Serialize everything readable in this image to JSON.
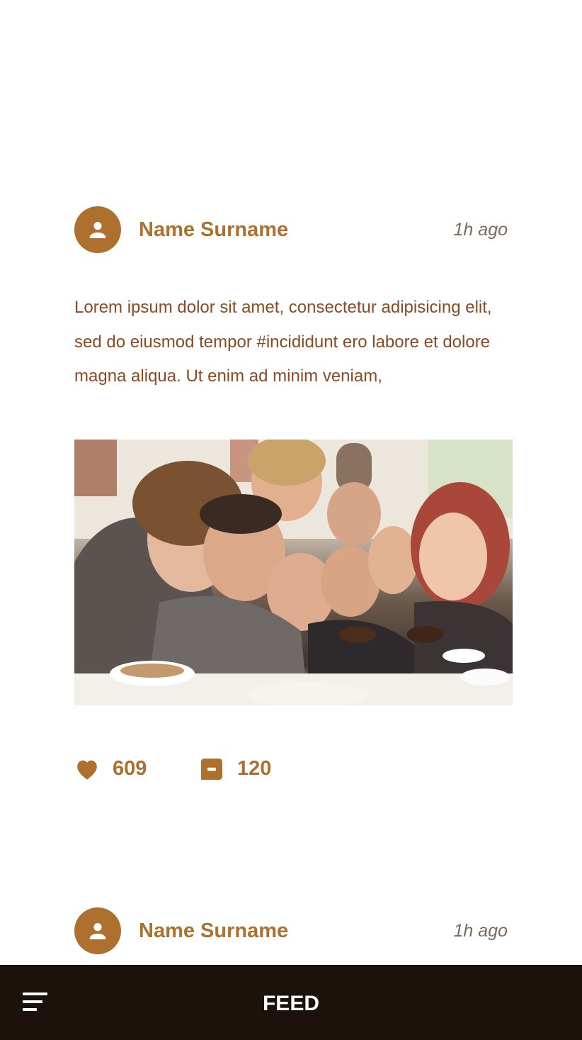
{
  "posts": [
    {
      "author": "Name Surname",
      "time": "1h ago",
      "text": "Lorem ipsum dolor sit amet, consectetur adipisicing elit, sed do eiusmod tempor #incididunt ero labore et dolore magna aliqua. Ut enim ad minim veniam,",
      "likes": "609",
      "comments": "120"
    },
    {
      "author": "Name Surname",
      "time": "1h ago"
    }
  ],
  "bottom_bar": {
    "title": "FEED"
  },
  "colors": {
    "accent": "#ad702f",
    "body_text": "#8b4a22",
    "time_text": "#7a6a5c",
    "bar_background": "#1c110b"
  },
  "icons": {
    "avatar": "user-icon",
    "likes": "heart-icon",
    "comments": "comment-icon",
    "menu": "menu-icon"
  }
}
